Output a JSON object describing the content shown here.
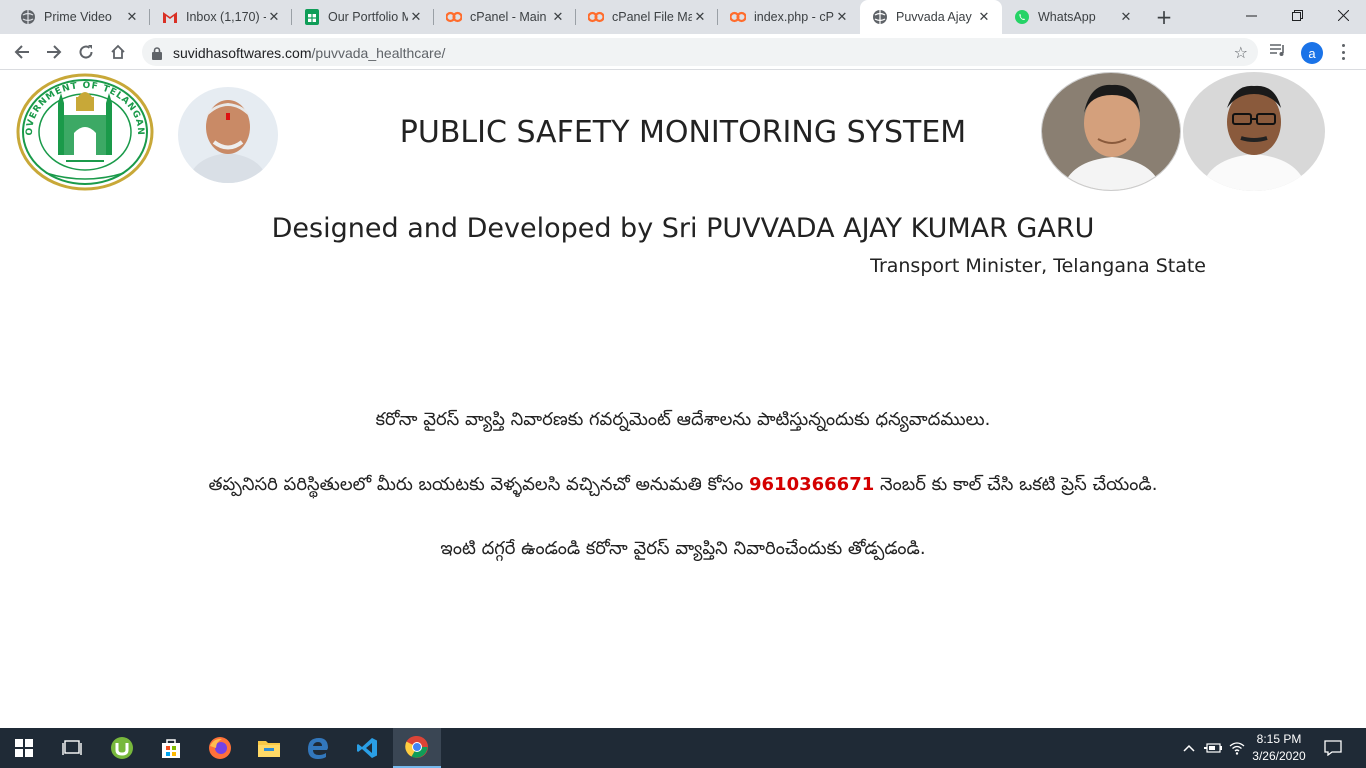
{
  "browser": {
    "tabs": [
      {
        "title": "Prime Video",
        "icon": "globe-icon"
      },
      {
        "title": "Inbox (1,170) -",
        "icon": "gmail-icon"
      },
      {
        "title": "Our Portfolio M",
        "icon": "sheets-icon"
      },
      {
        "title": "cPanel - Main",
        "icon": "cpanel-icon"
      },
      {
        "title": "cPanel File Ma",
        "icon": "cpanel-icon"
      },
      {
        "title": "index.php - cP",
        "icon": "cpanel-icon"
      },
      {
        "title": "Puvvada Ajay K",
        "icon": "globe-icon",
        "active": true
      },
      {
        "title": "WhatsApp",
        "icon": "whatsapp-icon"
      }
    ],
    "url_host": "suvidhasoftwares.com",
    "url_path": "/puvvada_healthcare/",
    "profile_initial": "a"
  },
  "page": {
    "title": "PUBLIC SAFETY MONITORING SYSTEM",
    "designed_by": "Designed and Developed by Sri PUVVADA AJAY KUMAR GARU",
    "designation": "Transport Minister, Telangana State",
    "emblem_text_top": "GOVERNMENT OF TELANGANA",
    "messages": {
      "line1": "కరోనా వైరస్ వ్యాప్తి నివారణకు గవర్నమెంట్ ఆదేశాలను పాటిస్తున్నందుకు ధన్యవాదములు.",
      "line2_before": "తప్పనిసరి పరిస్థితులలో మీరు బయటకు వెళ్ళవలసి వచ్చినచో అనుమతి కోసం",
      "phone": "9610366671",
      "line2_after": "నెంబర్ కు కాల్ చేసి ఒకటి ప్రెస్ చేయండి.",
      "line3": "ఇంటి దగ్గరే ఉండండి కరోనా వైరస్ వ్యాప్తిని నివారించేందుకు తోడ్పడండి."
    }
  },
  "taskbar": {
    "time": "8:15 PM",
    "date": "3/26/2020"
  },
  "colors": {
    "phone": "#d40000",
    "tabstrip": "#dee1e6",
    "taskbar": "#1f2a36",
    "emblem_green": "#1a9a4a"
  }
}
